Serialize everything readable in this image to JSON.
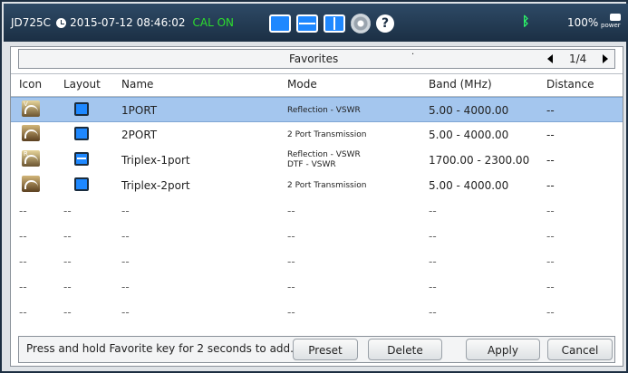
{
  "status_bar": {
    "model": "JD725C",
    "datetime": "2015-07-12 08:46:02",
    "cal_status": "CAL ON",
    "battery": "100%",
    "power_label": "power"
  },
  "panel": {
    "title": "Favorites",
    "dot": "·",
    "page": "1/4"
  },
  "columns": {
    "icon": "Icon",
    "layout": "Layout",
    "name": "Name",
    "mode": "Mode",
    "band": "Band (MHz)",
    "distance": "Distance"
  },
  "rows": [
    {
      "icon_letter": "V",
      "layout": "single",
      "name": "1PORT",
      "mode": "Reflection - VSWR",
      "mode2": "",
      "band": "5.00 - 4000.00",
      "distance": "--"
    },
    {
      "icon_letter": "",
      "layout": "single",
      "name": "2PORT",
      "mode": "2 Port Transmission",
      "mode2": "",
      "band": "5.00 - 4000.00",
      "distance": "--"
    },
    {
      "icon_letter": "R",
      "layout": "split",
      "name": "Triplex-1port",
      "mode": "Reflection - VSWR",
      "mode2": "DTF - VSWR",
      "band": "1700.00 - 2300.00",
      "distance": "--"
    },
    {
      "icon_letter": "",
      "layout": "single",
      "name": "Triplex-2port",
      "mode": "2 Port Transmission",
      "mode2": "",
      "band": "5.00 - 4000.00",
      "distance": "--"
    }
  ],
  "empty_cell": "--",
  "footer": {
    "hint": "Press and hold Favorite key for 2 seconds to add.",
    "preset": "Preset",
    "delete": "Delete",
    "apply": "Apply",
    "cancel": "Cancel"
  },
  "colors": {
    "selected_row": "#a4c6ee",
    "cal_on": "#2dde2d",
    "accent": "#1e88ff"
  }
}
